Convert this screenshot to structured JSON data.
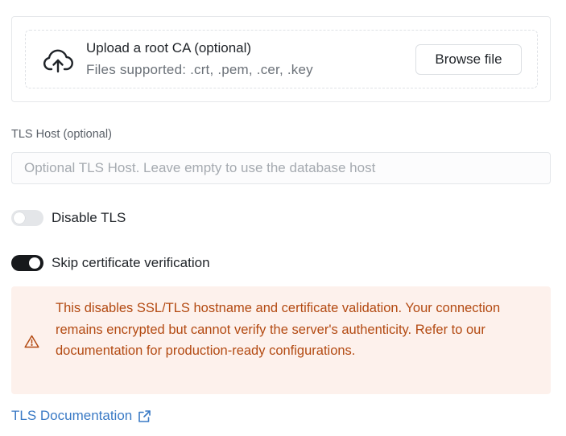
{
  "upload": {
    "icon": "cloud-upload-icon",
    "title": "Upload a root CA (optional)",
    "subtitle": "Files supported: .crt, .pem, .cer, .key",
    "browse_label": "Browse file"
  },
  "tls_host": {
    "label": "TLS Host (optional)",
    "value": "",
    "placeholder": "Optional TLS Host. Leave empty to use the database host"
  },
  "toggles": {
    "disable_tls": {
      "label": "Disable TLS",
      "checked": false
    },
    "skip_verification": {
      "label": "Skip certificate verification",
      "checked": true
    }
  },
  "warning": {
    "icon": "warning-triangle-icon",
    "text": "This disables SSL/TLS hostname and certificate validation. Your connection remains encrypted but cannot verify the server's authenticity. Refer to our documentation for production-ready configurations."
  },
  "docs_link": {
    "label": "TLS Documentation",
    "icon": "external-link-icon"
  },
  "colors": {
    "warning_bg": "#fdf1ec",
    "warning_text": "#b34a12",
    "link": "#3a7ac5",
    "toggle_on": "#17191c",
    "toggle_off": "#e4e6e9"
  }
}
